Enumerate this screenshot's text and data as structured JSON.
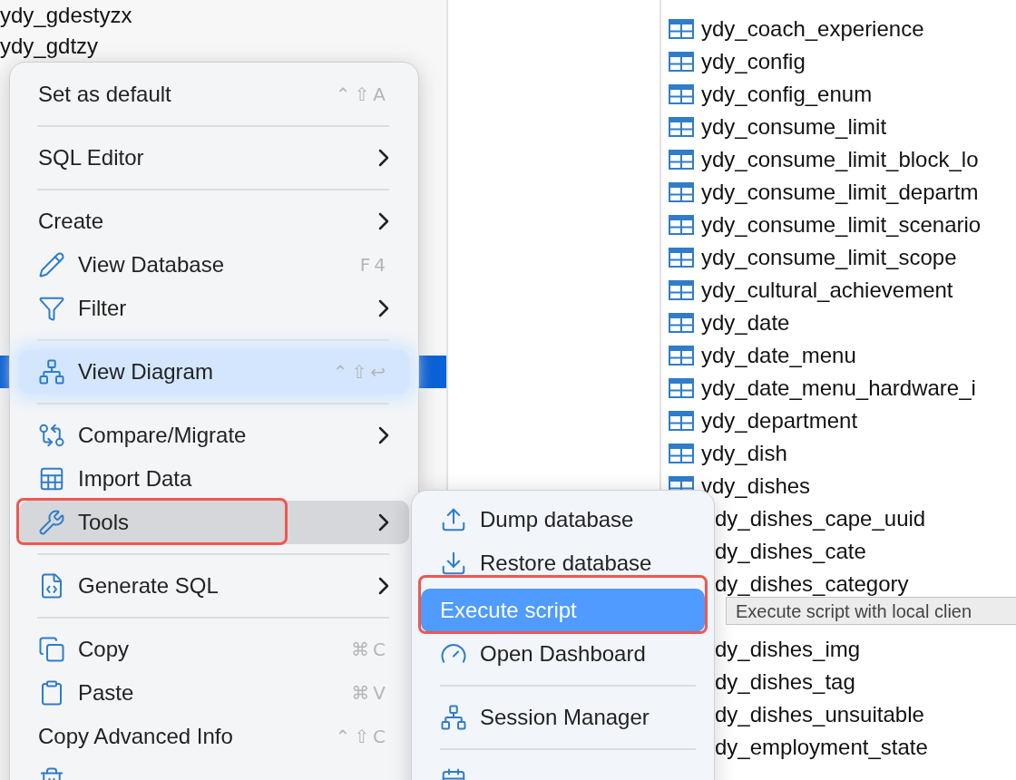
{
  "left_tree": {
    "items": [
      {
        "label": "ydy_gdestyzx"
      },
      {
        "label": "ydy_gdtzy"
      }
    ]
  },
  "table_list": {
    "items": [
      {
        "kind": "table",
        "label": "ydy_coach_experience"
      },
      {
        "kind": "table",
        "label": "ydy_config"
      },
      {
        "kind": "table",
        "label": "ydy_config_enum"
      },
      {
        "kind": "table",
        "label": "ydy_consume_limit"
      },
      {
        "kind": "table",
        "label": "ydy_consume_limit_block_lo"
      },
      {
        "kind": "table",
        "label": "ydy_consume_limit_departm"
      },
      {
        "kind": "table",
        "label": "ydy_consume_limit_scenario"
      },
      {
        "kind": "table",
        "label": "ydy_consume_limit_scope"
      },
      {
        "kind": "table",
        "label": "ydy_cultural_achievement"
      },
      {
        "kind": "table",
        "label": "ydy_date"
      },
      {
        "kind": "table",
        "label": "ydy_date_menu"
      },
      {
        "kind": "table",
        "label": "ydy_date_menu_hardware_i"
      },
      {
        "kind": "table",
        "label": "ydy_department"
      },
      {
        "kind": "table",
        "label": "ydy_dish"
      },
      {
        "kind": "table",
        "label": "vdy_dishes"
      },
      {
        "kind": "partial",
        "label": "dy_dishes_cape_uuid"
      },
      {
        "kind": "partial",
        "label": "dy_dishes_cate"
      },
      {
        "kind": "partial",
        "label": "dy_dishes_category"
      }
    ]
  },
  "table_list_below_tooltip": {
    "items": [
      {
        "kind": "partial",
        "label": "dy_dishes_img"
      },
      {
        "kind": "partial",
        "label": "dy_dishes_tag"
      },
      {
        "kind": "partial",
        "label": "dy_dishes_unsuitable"
      },
      {
        "kind": "partial",
        "label": "dy_employment_state"
      }
    ]
  },
  "context_menu": {
    "items": [
      {
        "kind": "item",
        "label": "Set as default",
        "shortcut": "⌃⇧A",
        "submenu": false,
        "selected": false,
        "highlighted": false
      },
      {
        "kind": "separator"
      },
      {
        "kind": "item",
        "label": "SQL Editor",
        "submenu": true,
        "selected": false,
        "highlighted": false
      },
      {
        "kind": "separator"
      },
      {
        "kind": "item",
        "label": "Create",
        "submenu": true,
        "selected": false,
        "highlighted": false
      },
      {
        "kind": "item",
        "label": "View Database",
        "shortcut": "F4",
        "submenu": false,
        "selected": false,
        "highlighted": false
      },
      {
        "kind": "item",
        "label": "Filter",
        "submenu": true,
        "selected": false,
        "highlighted": false
      },
      {
        "kind": "separator"
      },
      {
        "kind": "item",
        "label": "View Diagram",
        "shortcut": "⌃⇧↩",
        "submenu": false,
        "selected": false,
        "highlighted": true
      },
      {
        "kind": "separator"
      },
      {
        "kind": "item",
        "label": "Compare/Migrate",
        "submenu": true,
        "selected": false,
        "highlighted": false
      },
      {
        "kind": "item",
        "label": "Import Data",
        "submenu": false,
        "selected": false,
        "highlighted": false
      },
      {
        "kind": "item",
        "label": "Tools",
        "submenu": true,
        "selected": true,
        "highlighted": false
      },
      {
        "kind": "separator"
      },
      {
        "kind": "item",
        "label": "Generate SQL",
        "submenu": true,
        "selected": false,
        "highlighted": false
      },
      {
        "kind": "separator"
      },
      {
        "kind": "item",
        "label": "Copy",
        "shortcut": "⌘C",
        "submenu": false,
        "selected": false,
        "highlighted": false
      },
      {
        "kind": "item",
        "label": "Paste",
        "shortcut": "⌘V",
        "submenu": false,
        "selected": false,
        "highlighted": false
      },
      {
        "kind": "item",
        "label": "Copy Advanced Info",
        "shortcut": "⌃⇧C",
        "submenu": false,
        "selected": false,
        "highlighted": false
      },
      {
        "kind": "item",
        "submenu": false,
        "selected": false,
        "highlighted": false
      }
    ]
  },
  "tools_submenu": {
    "items": [
      {
        "kind": "item",
        "label": "Dump database",
        "selected": false
      },
      {
        "kind": "item",
        "label": "Restore database",
        "selected": false
      },
      {
        "kind": "item",
        "label": "Execute script",
        "selected": true
      },
      {
        "kind": "item",
        "label": "Open Dashboard",
        "selected": false
      },
      {
        "kind": "separator"
      },
      {
        "kind": "item",
        "label": "Session Manager",
        "selected": false
      },
      {
        "kind": "separator"
      },
      {
        "kind": "item",
        "selected": false
      }
    ]
  },
  "tooltip": {
    "text": "Execute script with local clien"
  }
}
